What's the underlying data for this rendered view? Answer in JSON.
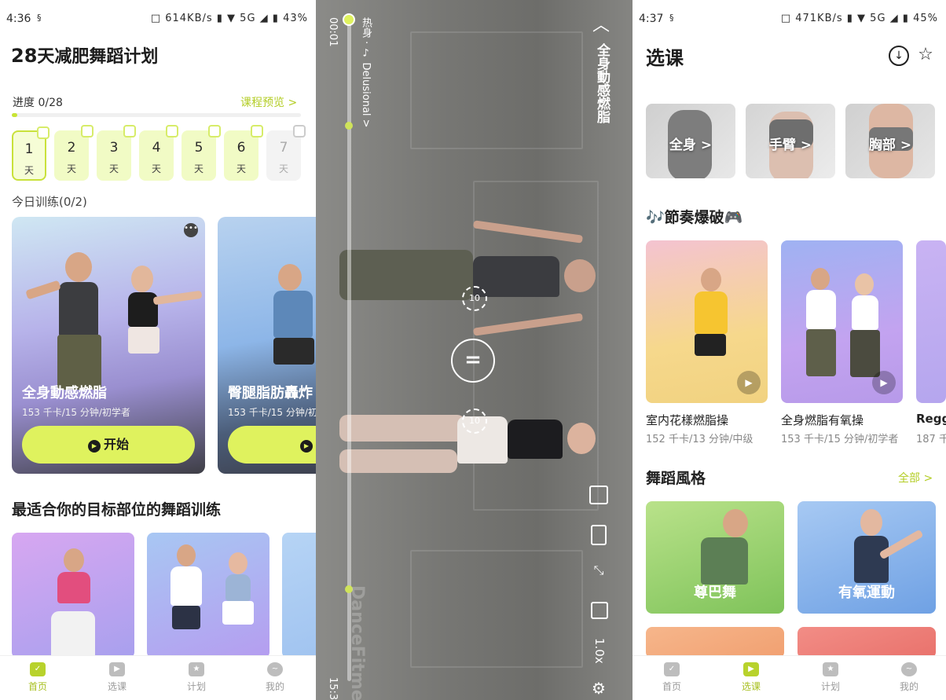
{
  "left": {
    "status": {
      "time": "4:36",
      "sys_icons": "□ 614KB/s ▮ ▼ 5G ◢ ▮",
      "battery": "43%"
    },
    "plan_title_num": "28",
    "plan_title_text": "天减肥舞蹈计划",
    "progress_label": "进度 0/28",
    "progress_fraction": 0.02,
    "preview_link": "课程预览 >",
    "days": [
      {
        "num": "1",
        "unit": "天"
      },
      {
        "num": "2",
        "unit": "天"
      },
      {
        "num": "3",
        "unit": "天"
      },
      {
        "num": "4",
        "unit": "天"
      },
      {
        "num": "5",
        "unit": "天"
      },
      {
        "num": "6",
        "unit": "天"
      },
      {
        "num": "7",
        "unit": "天"
      }
    ],
    "today_label": "今日训练(0/2)",
    "courses": [
      {
        "title": "全身動感燃脂",
        "meta": "153 千卡/15 分钟/初学者",
        "start": "开始"
      },
      {
        "title": "臀腿脂肪轟炸",
        "meta": "153 千卡/15 分钟/初",
        "start": "开"
      }
    ],
    "target_section": "最适合你的目标部位的舞蹈训练",
    "nav": [
      "首页",
      "选课",
      "计划",
      "我的"
    ]
  },
  "middle": {
    "time_start": "00:01",
    "time_end": "15:3",
    "segment": "热身 · ♪ Delusional >",
    "title": "全身動感燃脂",
    "rewind": "10",
    "forward": "10",
    "pause": "=",
    "speed": "1.0x",
    "watermark": "DanceFitme",
    "collapse_icon": "chevron-up-icon"
  },
  "right": {
    "status": {
      "time": "4:37",
      "sys_icons": "□ 471KB/s ▮ ▼ 5G ◢ ▮",
      "battery": "45%"
    },
    "title": "选课",
    "bodyparts": [
      "全身 >",
      "手臂 >",
      "胸部 >"
    ],
    "rhythm_section": "🎶節奏爆破🎮",
    "rhythm_cards": [
      {
        "title": "室内花樣燃脂操",
        "meta": "152 千卡/13 分钟/中级"
      },
      {
        "title": "全身燃脂有氧操",
        "meta": "153 千卡/15 分钟/初学者"
      },
      {
        "title": "Regg",
        "meta": "187 千"
      }
    ],
    "style_section": "舞蹈風格",
    "all_link": "全部 >",
    "styles": [
      "尊巴舞",
      "有氧運動"
    ],
    "nav": [
      "首页",
      "选课",
      "计划",
      "我的"
    ]
  },
  "colors": {
    "accent": "#dff25e",
    "accent_dark": "#b3cd25",
    "text": "#1c1c1c"
  }
}
